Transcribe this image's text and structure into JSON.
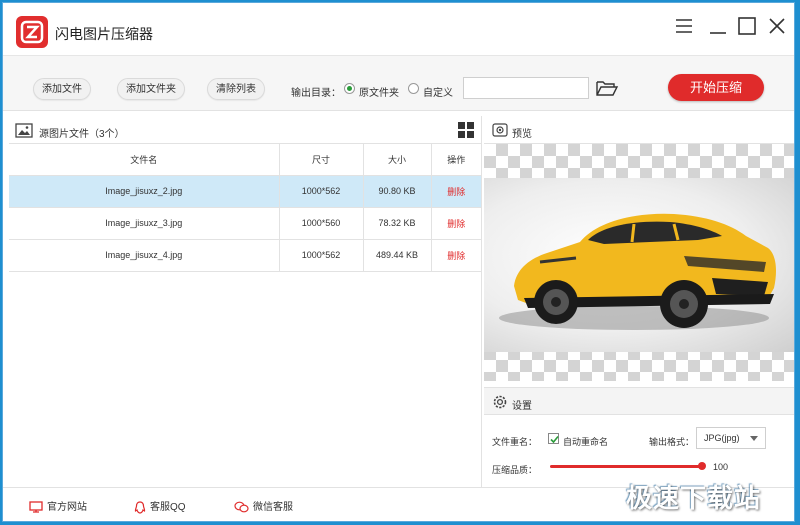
{
  "app": {
    "title": "闪电图片压缩器",
    "accent": "#e02b2b",
    "select_bg": "#cfe9f8"
  },
  "window_controls": {
    "menu": "menu-icon",
    "minimize": "minimize-icon",
    "maximize": "maximize-icon",
    "close": "close-icon"
  },
  "toolbar": {
    "add_file": "添加文件",
    "add_folder": "添加文件夹",
    "clear_list": "清除列表",
    "output_dir_label": "输出目录：",
    "opt_original": "原文件夹",
    "opt_custom": "自定义",
    "selected_option": "原文件夹",
    "path_value": "",
    "start": "开始压缩"
  },
  "file_list": {
    "title": "源图片文件（3个）",
    "columns": [
      "文件名",
      "尺寸",
      "大小",
      "操作"
    ],
    "rows": [
      {
        "name": "Image_jisuxz_2.jpg",
        "size": "1000*562",
        "bytes": "90.80 KB",
        "action": "删除",
        "selected": true
      },
      {
        "name": "Image_jisuxz_3.jpg",
        "size": "1000*560",
        "bytes": "78.32 KB",
        "action": "删除",
        "selected": false
      },
      {
        "name": "Image_jisuxz_4.jpg",
        "size": "1000*562",
        "bytes": "489.44 KB",
        "action": "删除",
        "selected": false
      }
    ]
  },
  "preview": {
    "title": "预览"
  },
  "settings": {
    "title": "设置",
    "rename_label": "文件重名：",
    "auto_rename": "自动重命名",
    "auto_rename_checked": true,
    "format_label": "输出格式：",
    "format_value": "JPG(jpg)",
    "quality_label": "压缩品质：",
    "quality_value": "100",
    "quality_fraction": 1.0
  },
  "footer": {
    "website": "官方网站",
    "qq": "客服QQ",
    "wechat": "微信客服"
  },
  "watermark": "极速下载站"
}
